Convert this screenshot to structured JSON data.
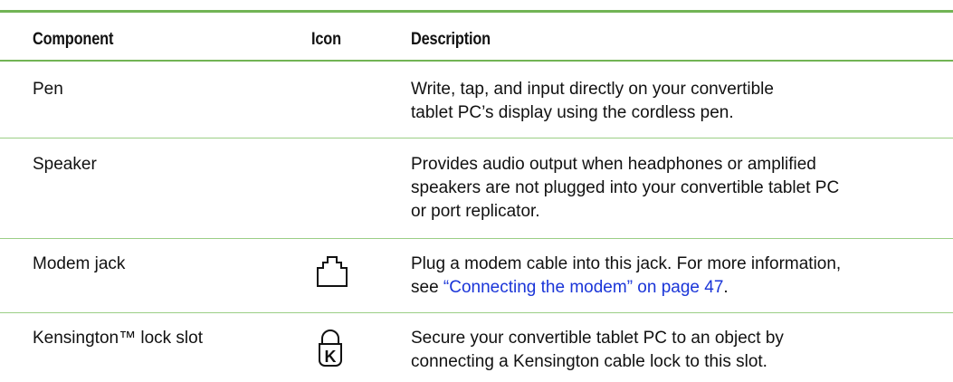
{
  "table": {
    "headers": {
      "component": "Component",
      "icon": "Icon",
      "description": "Description"
    },
    "rows": [
      {
        "component": "Pen",
        "icon": "",
        "description_lines": [
          "Write, tap, and input directly on your convertible",
          "tablet PC’s display using the cordless pen."
        ]
      },
      {
        "component": "Speaker",
        "icon": "",
        "description_lines": [
          "Provides audio output when headphones or amplified",
          "speakers are not plugged into your convertible tablet PC",
          "or port replicator."
        ]
      },
      {
        "component": "Modem jack",
        "icon": "modem-jack-icon",
        "description_lines": [
          "Plug a modem cable into this jack. For more information,"
        ],
        "description_prefix": "see ",
        "description_link": "“Connecting the modem” on page 47",
        "description_suffix": "."
      },
      {
        "component": "Kensington™ lock slot",
        "icon": "kensington-lock-icon",
        "icon_letter": "K",
        "description_lines": [
          "Secure your convertible tablet PC to an object by",
          "connecting a Kensington cable lock to this slot."
        ]
      }
    ]
  },
  "colors": {
    "rule": "#72b455",
    "row_rule": "#9bcf86",
    "link": "#1a35d8",
    "text": "#111111"
  }
}
